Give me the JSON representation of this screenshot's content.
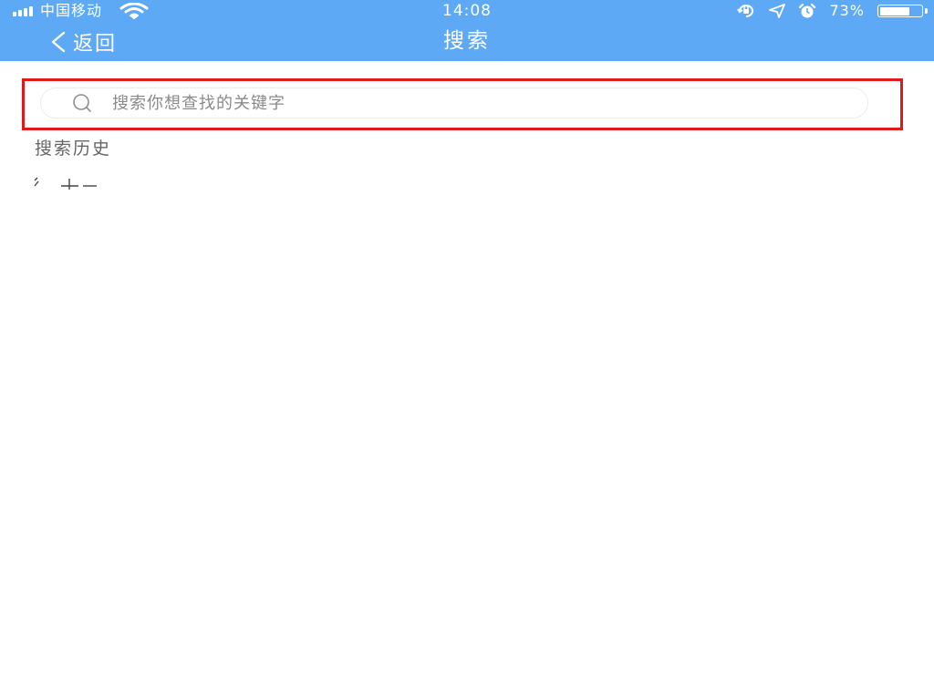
{
  "status_bar": {
    "carrier": "中国移动",
    "time": "14:08",
    "battery_percent": "73%",
    "battery_level": 0.73,
    "icons": [
      "signal-icon",
      "wifi-icon",
      "rotation-lock-icon",
      "location-icon",
      "alarm-icon",
      "battery-icon"
    ]
  },
  "nav": {
    "back_label": "返回",
    "title": "搜索"
  },
  "search": {
    "placeholder": "搜索你想查找的关键字",
    "value": ""
  },
  "history": {
    "title": "搜索历史"
  },
  "colors": {
    "header_bg": "#5ea9f5",
    "highlight_border": "#e01a1a",
    "placeholder": "#8a8a8a",
    "history_title": "#666666"
  }
}
